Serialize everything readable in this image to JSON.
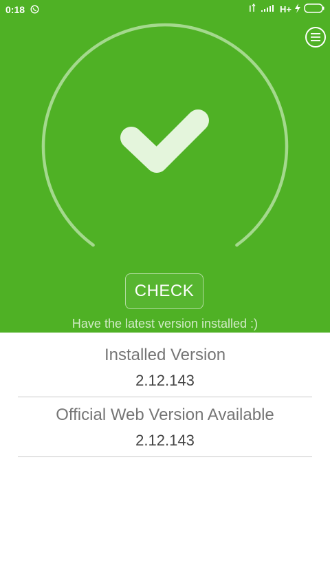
{
  "status_bar": {
    "time": "0:18",
    "network": "H+"
  },
  "hero": {
    "check_button_label": "CHECK",
    "status_message": "Have the latest version installed :)"
  },
  "installed": {
    "label": "Installed Version",
    "value": "2.12.143"
  },
  "official": {
    "label": "Official Web Version Available",
    "value": "2.12.143"
  },
  "colors": {
    "brand_green": "#4fb125",
    "check_mark": "#e4f5dc"
  },
  "icons": [
    "whatsapp-icon",
    "signal-icon",
    "battery-icon",
    "menu-icon",
    "checkmark-icon"
  ]
}
